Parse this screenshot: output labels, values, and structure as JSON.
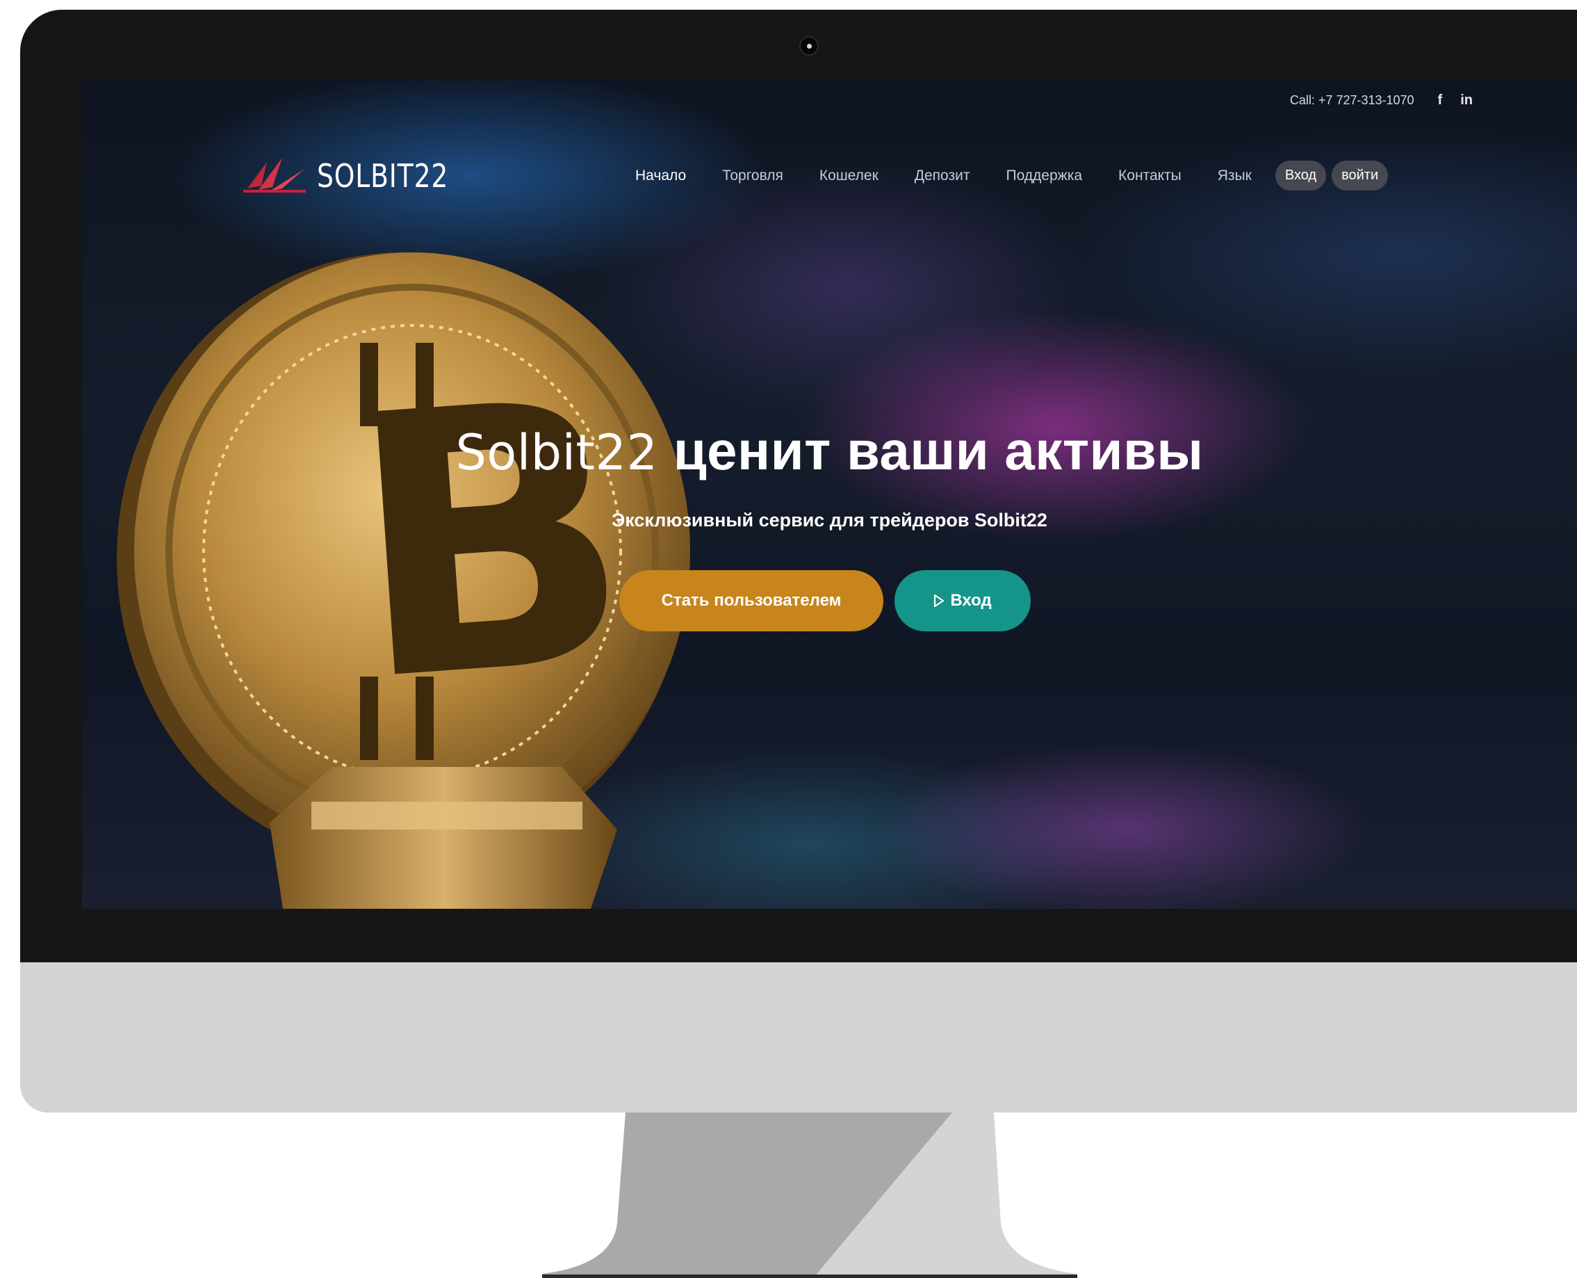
{
  "topbar": {
    "call": "Call: +7 727-313-1070",
    "social": [
      {
        "icon": "facebook-icon",
        "glyph": "f"
      },
      {
        "icon": "linkedin-icon",
        "glyph": "in"
      }
    ]
  },
  "header": {
    "logo_text": "SOLBIT22"
  },
  "nav": {
    "items": [
      "Начало",
      "Торговля",
      "Кошелек",
      "Депозит",
      "Поддержка",
      "Контакты",
      "Язык"
    ],
    "login_label": "Вход",
    "signup_label": "войти"
  },
  "hero": {
    "title_brand": "Solbit22",
    "title_rest": "ценит ваши активы",
    "subtitle": "Эксклюзивный сервис для трейдеров Solbit22",
    "primary_cta": "Стать пользователем",
    "secondary_cta_icon": "play-icon",
    "secondary_cta": "Вход"
  },
  "colors": {
    "primary_button": "#c8851c",
    "secondary_button": "#15958a",
    "logo_accent": "#c0253a"
  }
}
